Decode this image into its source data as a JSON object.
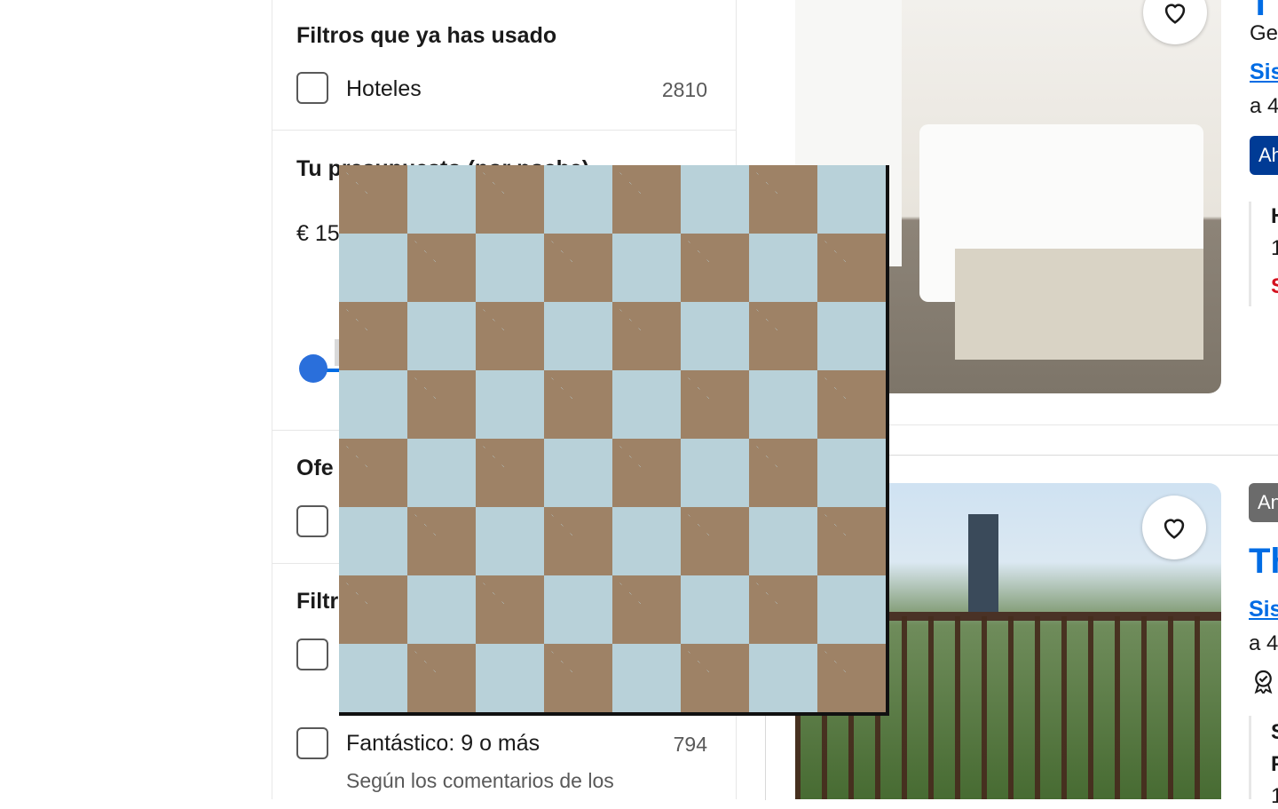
{
  "filters": {
    "used": {
      "title": "Filtros que ya has usado",
      "option_label": "Hoteles",
      "option_count": "2810"
    },
    "budget": {
      "title": "Tu presupuesto (por noche)",
      "price_min": "€ 15"
    },
    "offers": {
      "title": "Ofe"
    },
    "popular": {
      "title": "Filtr",
      "option2_label": "Fantástico: 9 o más",
      "option2_count": "794",
      "option2_sub": "Según los comentarios de los"
    }
  },
  "results": {
    "card1": {
      "title_partial": "T",
      "location_partial": "Ge",
      "map_link": "Sis",
      "distance_partial": "a 4",
      "badge_partial": "Ah",
      "room_partial": "H",
      "room_line2": "1",
      "red_partial": "S"
    },
    "card2": {
      "badge_partial": "An",
      "title_partial": "Th",
      "map_link": "Sis",
      "distance_partial": "a 4",
      "room_partial": "S",
      "room_line2": "F",
      "room_line3": "1"
    }
  },
  "colors": {
    "accent_blue": "#006ce4",
    "dark_blue": "#003b95",
    "red": "#d4111e",
    "checker_brown": "#9e8266",
    "checker_blue": "#b8d1d9"
  },
  "icons": [
    "heart-icon",
    "award-icon"
  ]
}
